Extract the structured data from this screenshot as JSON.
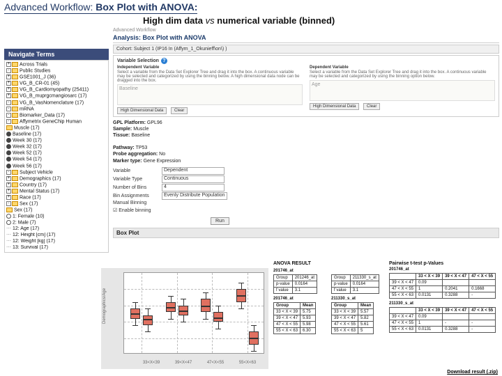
{
  "slide": {
    "prefix": "Advanced Workflow: ",
    "bold": "Box Plot with ANOVA:",
    "sub_a": "High dim data ",
    "sub_it": "vs",
    "sub_b": " numerical variable (binned)"
  },
  "nav": {
    "header": "Navigate Terms",
    "items": [
      {
        "ind": "i1",
        "exp": "+",
        "f": true,
        "t": "Across Trials"
      },
      {
        "ind": "i1",
        "exp": "-",
        "f": true,
        "t": "Public Studies"
      },
      {
        "ind": "i2",
        "exp": "+",
        "f": true,
        "t": "GSE1001_J (36)"
      },
      {
        "ind": "i2",
        "exp": "+",
        "f": true,
        "t": "VG_B_CR-01 (45)"
      },
      {
        "ind": "i2",
        "exp": "+",
        "f": true,
        "t": "VG_B_Cardiomyopathy (25411)"
      },
      {
        "ind": "i2",
        "exp": "+",
        "f": true,
        "t": "VG_B_muprgcmangiosarc (17)"
      },
      {
        "ind": "i2",
        "exp": "-",
        "f": true,
        "t": "VG_B_VasNomenclature (17)"
      },
      {
        "ind": "i3",
        "exp": "-",
        "f": true,
        "t": "mRNA"
      },
      {
        "ind": "i4",
        "exp": "-",
        "f": true,
        "t": "Biomarker_Data (17)"
      },
      {
        "ind": "i5",
        "exp": "-",
        "f": true,
        "t": "Affymetrix GeneChip Human"
      },
      {
        "ind": "i5",
        "leafy": true,
        "t": "Muscle (17)"
      },
      {
        "ind": "i5",
        "dot": true,
        "t": "Baseline (17)"
      },
      {
        "ind": "i5",
        "dot": true,
        "t": "Week 30 (17)"
      },
      {
        "ind": "i5",
        "dot": true,
        "t": "Week 32 (17)"
      },
      {
        "ind": "i5",
        "dot": true,
        "t": "Week 52 (17)"
      },
      {
        "ind": "i5",
        "dot": true,
        "t": "Week 54 (17)"
      },
      {
        "ind": "i5",
        "dot": true,
        "t": "Week 56 (17)"
      },
      {
        "ind": "i3",
        "exp": "-",
        "f": true,
        "t": "Subject Vehicle"
      },
      {
        "ind": "i4",
        "exp": "+",
        "f": true,
        "t": "Demographics (17)"
      },
      {
        "ind": "i4",
        "exp": "+",
        "f": true,
        "t": "Country (17)"
      },
      {
        "ind": "i4",
        "exp": "+",
        "f": true,
        "t": "Mental Status (17)"
      },
      {
        "ind": "i4",
        "exp": "+",
        "f": true,
        "t": "Race (17)"
      },
      {
        "ind": "i4",
        "exp": "-",
        "f": true,
        "t": "Sex (17)"
      },
      {
        "ind": "i5",
        "leafy": true,
        "t": "Sex (17)"
      },
      {
        "ind": "i5",
        "o": true,
        "t": "1: Female (10)"
      },
      {
        "ind": "i5",
        "o": true,
        "t": "2: Male (7)"
      },
      {
        "ind": "i4",
        "txt": true,
        "t": "12: Age (17)"
      },
      {
        "ind": "i4",
        "txt": true,
        "t": "12: Height [cm] (17)"
      },
      {
        "ind": "i4",
        "txt": true,
        "t": "12: Weight [kg] (17)"
      },
      {
        "ind": "i4",
        "txt": true,
        "t": "13: Survival (17)"
      }
    ]
  },
  "main": {
    "crumb": "Advanced Workflow",
    "title": "Analysis: Box Plot with ANOVA",
    "cohort": "Cohort: Subject 1 (IP16 In (Affym_1_Okunieff\\on\\) )",
    "section": "Variable Selection",
    "indep": {
      "h": "Independent Variable",
      "txt": "Select a variable from the Data Set Explorer Tree and drag it into the box. A continuous variable may be selected and categorized by using the binning below. A high dimensional data node can be dragged into the box.",
      "drop": "Baseline"
    },
    "dep": {
      "h": "Dependent Variable",
      "txt": "Select a variable from the Data Set Explorer Tree and drag it into the box. A continuous variable may be selected and categorized by using the binning option below.",
      "drop": "Age"
    },
    "btn_hdd": "High Dimensional Data",
    "btn_clear": "Clear",
    "info": {
      "k1": "GPL Platform:",
      "v1": "GPL96",
      "k2": "Sample:",
      "v2": "Muscle",
      "k3": "Tissue:",
      "v3": "Baseline",
      "k4": "Pathway:",
      "v4": "TP53",
      "k5": "Probe aggregation:",
      "v5": "No",
      "k6": "Marker type:",
      "v6": "Gene Expression"
    },
    "form": {
      "l1": "Variable",
      "v1": "Dependent",
      "l2": "Variable Type",
      "v2": "Continuous",
      "l3": "Number of Bins",
      "v3": "4",
      "l4": "Bin Assignments",
      "v4": "Evenly Distribute Population",
      "l5": "Manual Binning"
    },
    "enable": "Enable binning",
    "run": "Run",
    "bphead": "Box Plot"
  },
  "tables": {
    "anova": "ANOVA RESULT",
    "pw": "Pairwise t-test p-Values",
    "a1": {
      "id": "201746_at",
      "rows": [
        [
          "Group",
          "201246_at"
        ],
        [
          "p-value",
          "0.0164"
        ],
        [
          "f value",
          "3.1"
        ]
      ]
    },
    "a2": {
      "rows": [
        [
          "Group",
          "211330_s_at"
        ],
        [
          "p-value",
          "0.0164"
        ],
        [
          "f value",
          "3.1"
        ]
      ]
    },
    "pw_id": "201746_at",
    "pw1": {
      "head": [
        "",
        "33 < X < 39",
        "39 < X < 47",
        "47 < X < 55"
      ],
      "rows": [
        [
          "39 < X < 47",
          "0.09",
          "",
          ""
        ],
        [
          "47 < X < 55",
          "1",
          "0.2041",
          "0.1668"
        ],
        [
          "55 < X < 63",
          "0.0131",
          "0.3288",
          "-"
        ]
      ]
    },
    "sid1": "201746_at",
    "sid2": "211330_s_at",
    "s1": {
      "head": [
        "Group",
        "Mean"
      ],
      "rows": [
        [
          "33 < X < 39",
          "5.75"
        ],
        [
          "39 < X < 47",
          "5.93"
        ],
        [
          "47 < X < 55",
          "5.98"
        ],
        [
          "55 < X < 63",
          "6.30"
        ]
      ]
    },
    "s2": {
      "head": [
        "Group",
        "Mean"
      ],
      "rows": [
        [
          "33 < X < 39",
          "5.57"
        ],
        [
          "39 < X < 47",
          "5.82"
        ],
        [
          "47 < X < 55",
          "5.61"
        ],
        [
          "55 < X < 63",
          "5"
        ]
      ]
    },
    "pw2_id": "211330_s_at",
    "pw2": {
      "head": [
        "",
        "33 < X < 39",
        "39 < X < 47",
        "47 < X < 55"
      ],
      "rows": [
        [
          "39 < X < 47",
          "0.09",
          "",
          ""
        ],
        [
          "47 < X < 55",
          "1",
          "-",
          "-"
        ],
        [
          "55 < X < 63",
          "0.0131",
          "0.3288",
          "-"
        ]
      ]
    }
  },
  "chart_data": {
    "type": "box",
    "title": "Box Plot",
    "ylabel": "Demographics/Age",
    "categories": [
      "33<X<39",
      "39<X<47",
      "47<X<55",
      "55<X<63"
    ],
    "series": [
      {
        "name": "201746_at",
        "values": [
          {
            "min": 5.4,
            "q1": 5.6,
            "med": 5.75,
            "q3": 5.9,
            "max": 6.1
          },
          {
            "min": 5.6,
            "q1": 5.8,
            "med": 5.93,
            "q3": 6.1,
            "max": 6.3
          },
          {
            "min": 5.6,
            "q1": 5.8,
            "med": 5.98,
            "q3": 6.2,
            "max": 6.4
          },
          {
            "min": 5.9,
            "q1": 6.1,
            "med": 6.3,
            "q3": 6.5,
            "max": 6.7
          }
        ]
      },
      {
        "name": "211330_s_at",
        "values": [
          {
            "min": 5.2,
            "q1": 5.4,
            "med": 5.57,
            "q3": 5.7,
            "max": 5.9
          },
          {
            "min": 5.5,
            "q1": 5.7,
            "med": 5.82,
            "q3": 6.0,
            "max": 6.2
          },
          {
            "min": 5.3,
            "q1": 5.5,
            "med": 5.61,
            "q3": 5.8,
            "max": 6.0
          },
          {
            "min": 4.6,
            "q1": 4.8,
            "med": 5.0,
            "q3": 5.2,
            "max": 5.4
          }
        ]
      }
    ],
    "ylim": [
      4.5,
      7.0
    ]
  },
  "dl": "Download result (.zip)"
}
